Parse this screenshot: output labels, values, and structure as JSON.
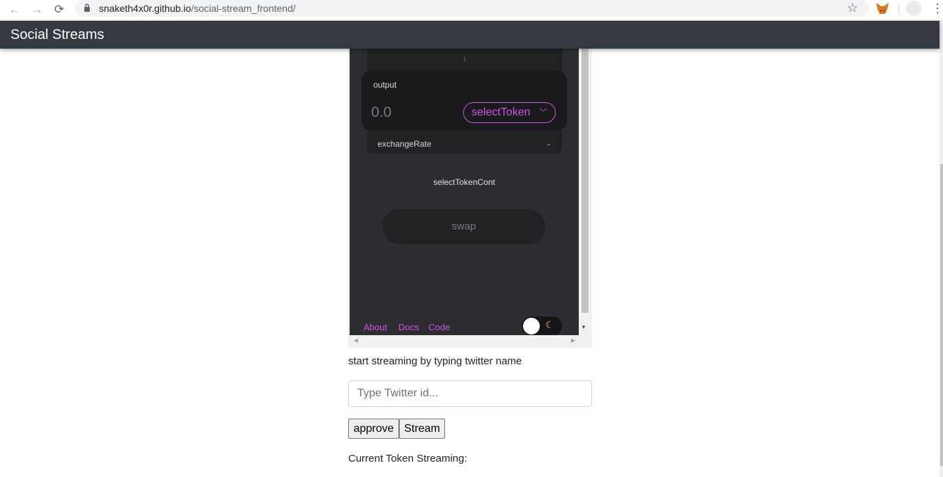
{
  "browser": {
    "url_host": "snaketh4x0r.github.io",
    "url_path": "/social-stream_frontend/"
  },
  "navbar": {
    "brand": "Social Streams"
  },
  "swap_widget": {
    "arrow": "↓",
    "output_label": "output",
    "output_value": "0.0",
    "select_token_label": "selectToken",
    "exchange_rate_label": "exchangeRate",
    "exchange_rate_value": "-",
    "select_token_cont": "selectTokenCont",
    "swap_label": "swap",
    "footer_links": [
      "About",
      "Docs",
      "Code"
    ],
    "theme_toggle": {
      "mode_icon": "moon-icon",
      "state": "dark"
    }
  },
  "stream": {
    "instruction": "start streaming by typing twitter name",
    "input_placeholder": "Type Twitter id...",
    "approve_label": "approve",
    "stream_label": "Stream",
    "current_token_label": "Current Token Streaming:"
  },
  "colors": {
    "navbar_bg": "#343a40",
    "widget_bg": "#2c2d30",
    "accent": "#d252e6"
  }
}
